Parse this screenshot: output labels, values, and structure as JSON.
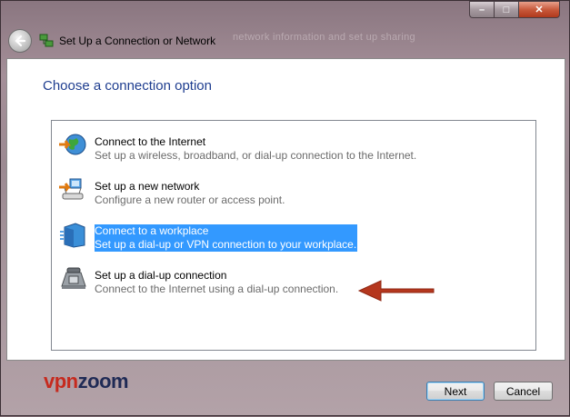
{
  "window": {
    "title": "Set Up a Connection or Network",
    "ghost_text": "network information and set up sharing"
  },
  "caption_buttons": {
    "minimize": "–",
    "maximize": "□",
    "close": "✕"
  },
  "heading": "Choose a connection option",
  "options": [
    {
      "title": "Connect to the Internet",
      "description": "Set up a wireless, broadband, or dial-up connection to the Internet.",
      "icon": "globe-icon",
      "selected": false
    },
    {
      "title": "Set up a new network",
      "description": "Configure a new router or access point.",
      "icon": "router-icon",
      "selected": false
    },
    {
      "title": "Connect to a workplace",
      "description": "Set up a dial-up or VPN connection to your workplace.",
      "icon": "workplace-icon",
      "selected": true
    },
    {
      "title": "Set up a dial-up connection",
      "description": "Connect to the Internet using a dial-up connection.",
      "icon": "phone-icon",
      "selected": false
    }
  ],
  "logo": {
    "part1": "vpn",
    "part2": "zoom"
  },
  "buttons": {
    "next": "Next",
    "cancel": "Cancel"
  },
  "colors": {
    "selection": "#3399ff",
    "heading": "#1e3d8f",
    "arrow": "#b5371e"
  }
}
